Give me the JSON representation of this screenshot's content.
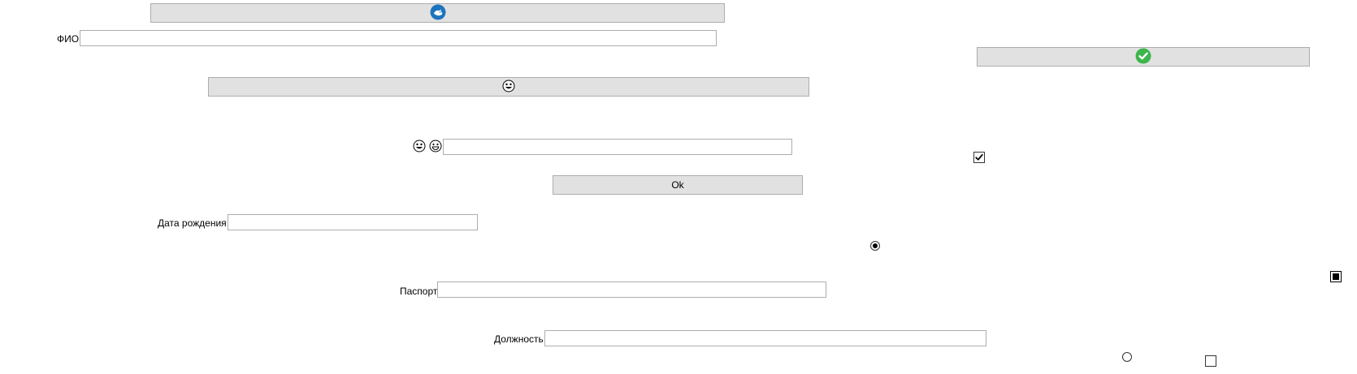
{
  "form": {
    "fio_label": "ФИО",
    "fio_value": "",
    "birthdate_label": "Дата рождения",
    "birthdate_value": "",
    "passport_label": "Паспорт",
    "passport_value": "",
    "position_label": "Должность",
    "position_value": "",
    "emoji_field_value": ""
  },
  "buttons": {
    "top_icon": "blue-circle-icon",
    "check_icon": "green-check-icon",
    "emoji_icon": "smiley-face-icon",
    "ok_label": "Ok"
  },
  "controls": {
    "checkbox_checked": true,
    "radio_selected": true,
    "square_checkbox_indeterminate": true,
    "radio_unselected": false,
    "checkbox_unchecked": false
  },
  "colors": {
    "button_bg": "#e1e1e1",
    "button_border": "#adadad",
    "field_border": "#abadb3",
    "blue_icon": "#1e73be",
    "green_icon": "#3cb54a"
  }
}
